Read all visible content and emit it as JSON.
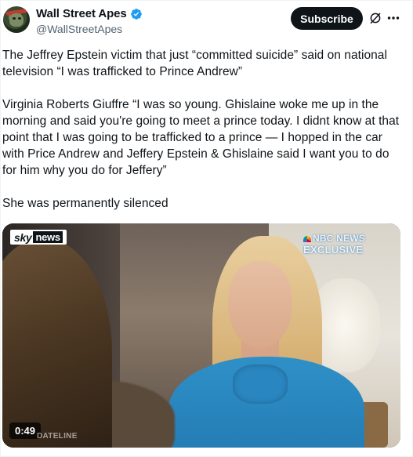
{
  "header": {
    "name": "Wall Street Apes",
    "handle": "@WallStreetApes",
    "subscribe_label": "Subscribe",
    "icons": [
      "avatar",
      "verified-badge-icon",
      "grok-icon",
      "more-icon"
    ]
  },
  "tweet": {
    "paragraphs": [
      "The Jeffrey Epstein victim that just “committed suicide” said on national television “I was trafficked to Prince Andrew”",
      "Virginia Roberts Giuffre “I was so young. Ghislaine woke me up in the morning and said you're going to meet a prince today. I didnt know at that point that I was going to be trafficked to a prince — I hopped in the car with Price Andrew and Jeffery Epstein & Ghislaine said I want you to do for him why you do for Jeffery”",
      "She was permanently silenced"
    ]
  },
  "media": {
    "duration": "0:49",
    "sky_logo_sky": "sky",
    "sky_logo_news": "news",
    "nbc_line1": "NBC NEWS",
    "nbc_line2": "EXCLUSIVE",
    "dateline": "DATELINE"
  },
  "colors": {
    "text": "#0f1419",
    "secondary": "#536471",
    "verified": "#1d9bf0",
    "button_bg": "#0f1419"
  }
}
